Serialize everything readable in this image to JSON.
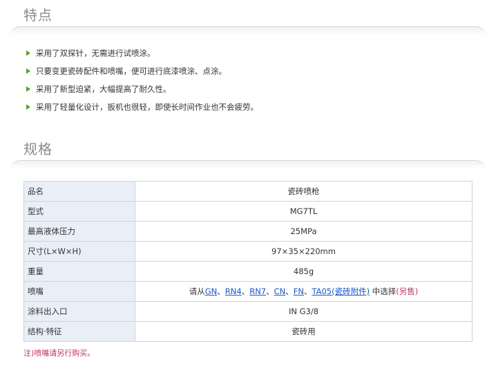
{
  "features_section": {
    "title": "特点",
    "items": [
      "采用了双探针，无需进行试喷涂。",
      "只要变更瓷砖配件和喷嘴，便可进行底漆喷涂、点涂。",
      "采用了新型迫紧，大幅提高了耐久性。",
      "采用了轻量化设计，扳机也很轻，即使长时间作业也不会疲劳。"
    ]
  },
  "spec_section": {
    "title": "规格",
    "rows": [
      {
        "label": "品名",
        "value": "瓷砖喷枪"
      },
      {
        "label": "型式",
        "value": "MG7TL"
      },
      {
        "label": "最高液体压力",
        "value": "25MPa"
      },
      {
        "label": "尺寸(L×W×H)",
        "value": "97×35×220mm"
      },
      {
        "label": "重量",
        "value": "485g"
      },
      {
        "label": "喷嘴",
        "value": ""
      },
      {
        "label": "涂料出入口",
        "value": "IN G3/8"
      },
      {
        "label": "结构·特征",
        "value": "瓷砖用"
      }
    ],
    "nozzle": {
      "prefix": "请从",
      "links": [
        "GN",
        "RN4",
        "RN7",
        "CN",
        "FN",
        "TA05(瓷砖附件)"
      ],
      "separator": "、",
      "suffix": "中选择",
      "note": "(另售)"
    },
    "footnote": "注)喷嘴请另行购买。"
  },
  "colors": {
    "bullet": "#5aa320",
    "link": "#1a56c4",
    "note": "#c0306a",
    "label_bg": "#e9eef7"
  }
}
